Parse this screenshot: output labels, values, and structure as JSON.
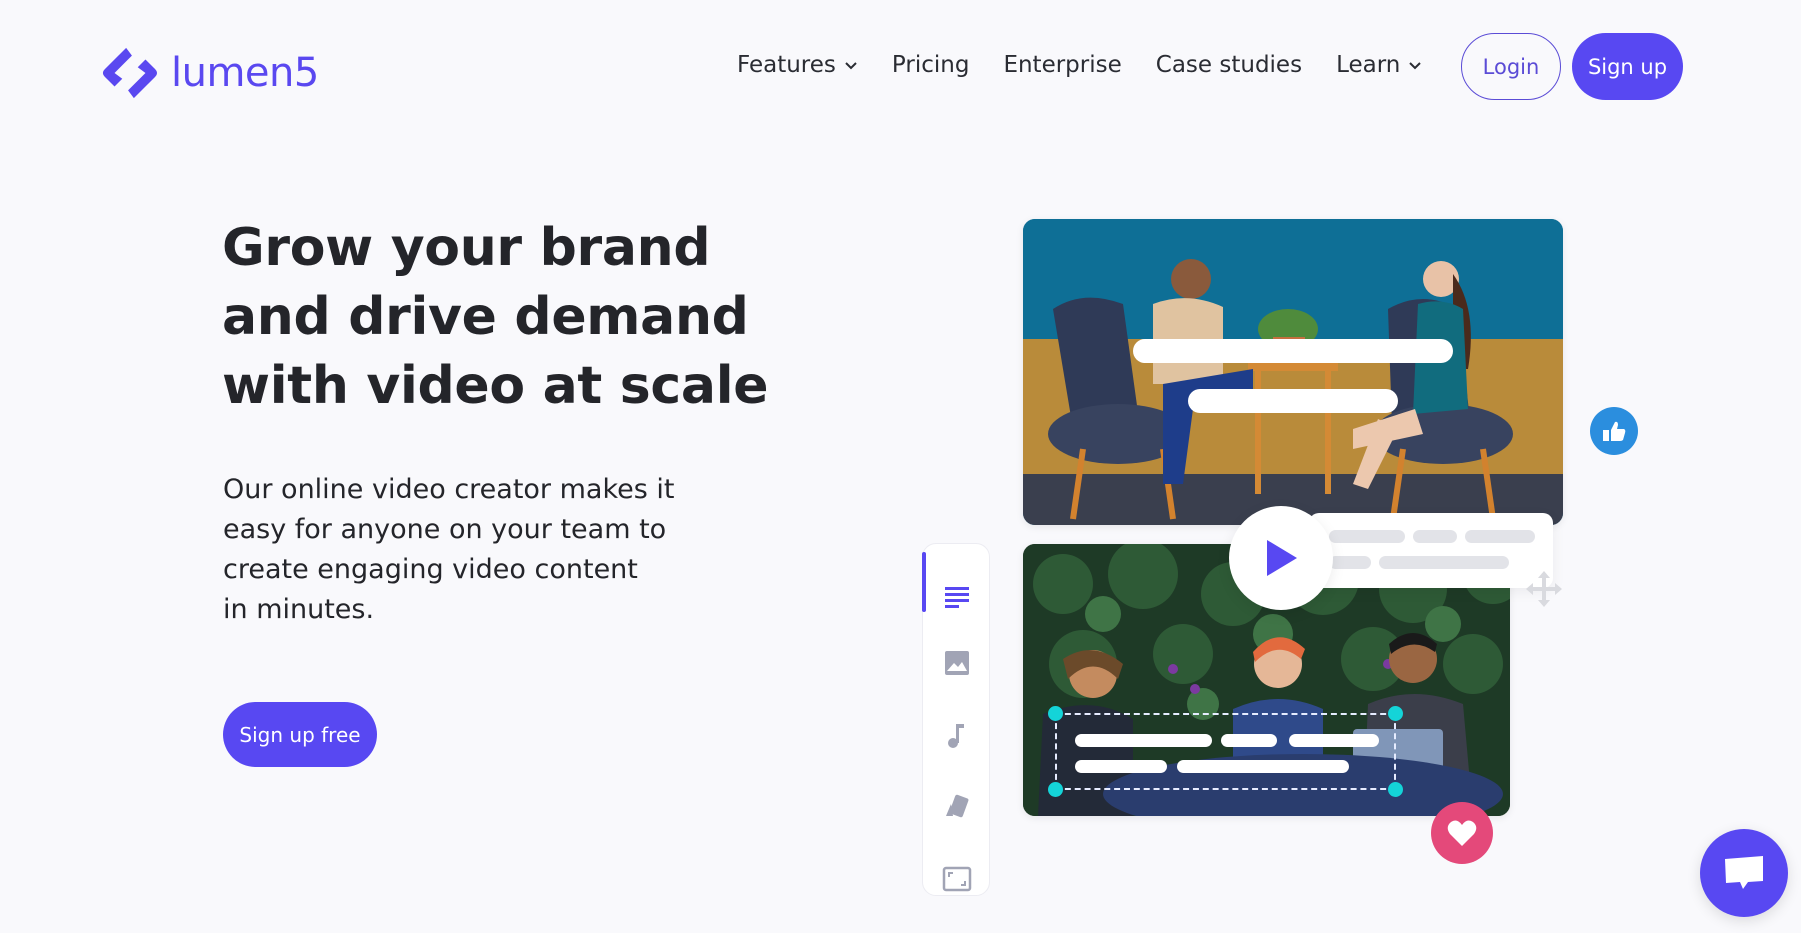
{
  "brand": {
    "name": "lumen5",
    "accent": "#5848f2"
  },
  "nav": {
    "items": [
      {
        "label": "Features",
        "has_dropdown": true
      },
      {
        "label": "Pricing",
        "has_dropdown": false
      },
      {
        "label": "Enterprise",
        "has_dropdown": false
      },
      {
        "label": "Case studies",
        "has_dropdown": false
      },
      {
        "label": "Learn",
        "has_dropdown": true
      }
    ],
    "login_label": "Login",
    "signup_label": "Sign up"
  },
  "hero": {
    "headline_lines": [
      "Grow your brand",
      "and drive demand",
      "with video at scale"
    ],
    "subtext_lines": [
      "Our online video creator makes it",
      "easy for anyone on your team to",
      "create engaging video content",
      "in minutes."
    ],
    "cta_label": "Sign up free"
  },
  "illustration": {
    "editor_tools": [
      "text-tool",
      "image-tool",
      "music-tool",
      "style-tool",
      "format-tool"
    ],
    "active_tool": "text-tool",
    "reactions": [
      "thumbs-up",
      "heart"
    ],
    "colors": {
      "thumbs": "#2b8ede",
      "heart": "#e4497a",
      "handle": "#14d4d8"
    }
  },
  "chat_widget": {
    "icon": "chat-bubble-icon"
  }
}
